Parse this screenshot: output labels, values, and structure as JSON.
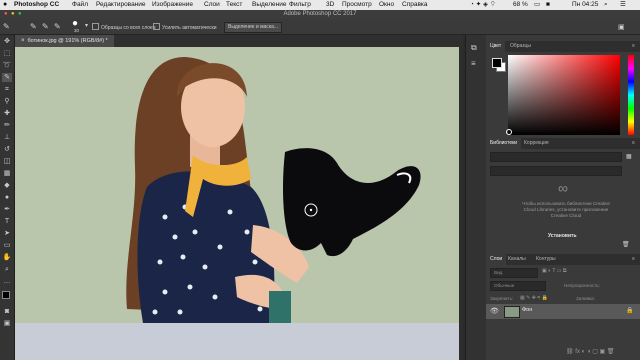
{
  "menubar": {
    "app": "Photoshop CC",
    "items": [
      "Файл",
      "Редактирование",
      "Изображение",
      "Слои",
      "Текст",
      "Выделение",
      "Фильтр",
      "3D",
      "Просмотр",
      "Окно",
      "Справка"
    ],
    "battery": "68 %",
    "time": "Пн 04:25"
  },
  "window_title": "Adobe Photoshop CC 2017",
  "options": {
    "brush_size": "30",
    "sample_all_layers": "Образцы со всех слоев",
    "auto_enhance": "Усилить автоматически",
    "select_mask_button": "Выделение и маска..."
  },
  "document": {
    "tab_label": "ботинок.jpg @ 191% (RGB/8#) *"
  },
  "color_panel": {
    "tabs": [
      "Цвет",
      "Образцы"
    ],
    "hue_color": "#ff0000"
  },
  "libraries_panel": {
    "tabs": [
      "Библиотеки",
      "Коррекция"
    ],
    "message": "Чтобы использовать библиотеки Creative Cloud Libraries, установите приложение Creative Cloud",
    "install_button": "Установить"
  },
  "layers_panel": {
    "tabs": [
      "Слои",
      "Каналы",
      "Контуры"
    ],
    "search_placeholder": "Вид",
    "blend_mode": "Обычные",
    "opacity_label": "Непрозрачность:",
    "lock_label": "Закрепить:",
    "fill_label": "Заливка:",
    "layers": [
      {
        "name": "Фон",
        "visible": true
      }
    ]
  }
}
